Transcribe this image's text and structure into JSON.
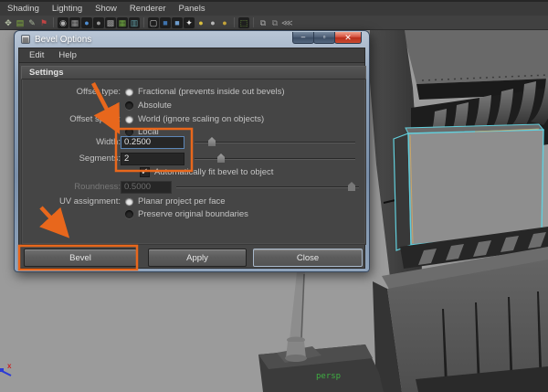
{
  "menu_bar": {
    "items": [
      "Shading",
      "Lighting",
      "Show",
      "Renderer",
      "Panels"
    ]
  },
  "toolbar": {
    "icons": [
      {
        "name": "select-tool-icon",
        "glyph": "✥",
        "fg": "#b8c4a8",
        "bg": "transparent"
      },
      {
        "name": "layer-book-icon",
        "glyph": "▤",
        "fg": "#86b33f",
        "bg": "transparent"
      },
      {
        "name": "graph-icon",
        "glyph": "✎",
        "fg": "#a9b79a",
        "bg": "transparent"
      },
      {
        "name": "key-icon",
        "glyph": "⚑",
        "fg": "#c24545",
        "bg": "transparent"
      },
      {
        "sep": true
      },
      {
        "name": "camera-icon",
        "glyph": "◉",
        "fg": "#b5b5b5",
        "bg": "#1f1f1f"
      },
      {
        "name": "film-gate-icon",
        "glyph": "▦",
        "fg": "#9b9b9b",
        "bg": "#1f1f1f"
      },
      {
        "name": "shaded-sphere-icon",
        "glyph": "●",
        "fg": "#4f8fd4",
        "bg": "#1f1f1f"
      },
      {
        "name": "wire-sphere-icon",
        "glyph": "●",
        "fg": "#9a9a9a",
        "bg": "#1f1f1f"
      },
      {
        "name": "checker-icon",
        "glyph": "▩",
        "fg": "#a5a5a5",
        "bg": "#1f1f1f"
      },
      {
        "name": "texture-grid-icon",
        "glyph": "▦",
        "fg": "#74b043",
        "bg": "#1f1f1f"
      },
      {
        "name": "film-strip-icon",
        "glyph": "▥",
        "fg": "#62a0a8",
        "bg": "#1f1f1f"
      },
      {
        "sep": true
      },
      {
        "name": "wire-cube-icon",
        "glyph": "▢",
        "fg": "#cfcfcf",
        "bg": "#1f1f1f"
      },
      {
        "name": "blue-cube-icon",
        "glyph": "■",
        "fg": "#3f74b0",
        "bg": "#1f1f1f"
      },
      {
        "name": "shaded-cube-icon",
        "glyph": "■",
        "fg": "#6f9fd0",
        "bg": "#1f1f1f"
      },
      {
        "name": "sparkle-icon",
        "glyph": "✦",
        "fg": "#e8e8e8",
        "bg": "#1f1f1f"
      },
      {
        "name": "yellow-light-icon",
        "glyph": "●",
        "fg": "#ddc23f",
        "bg": "transparent"
      },
      {
        "name": "gray-light-icon",
        "glyph": "●",
        "fg": "#b9b9b9",
        "bg": "transparent"
      },
      {
        "name": "amber-light-icon",
        "glyph": "●",
        "fg": "#c7a63a",
        "bg": "transparent"
      },
      {
        "sep": true
      },
      {
        "name": "snap-select-icon",
        "glyph": "⬚",
        "fg": "#7fb043",
        "bg": "#1f1f1f"
      },
      {
        "sep": true
      },
      {
        "name": "copy-layer-icon",
        "glyph": "⧉",
        "fg": "#ababab",
        "bg": "transparent"
      },
      {
        "name": "duplicate-icon",
        "glyph": "⧉",
        "fg": "#8f8f8f",
        "bg": "transparent"
      },
      {
        "name": "share-icon",
        "glyph": "⋘",
        "fg": "#9f9f9f",
        "bg": "transparent"
      }
    ]
  },
  "dialog": {
    "title": "Bevel Options",
    "title_icon_glyph": "▦",
    "window_controls": {
      "minimize": "–",
      "maximize": "▫",
      "close": "✕"
    },
    "menu": [
      "Edit",
      "Help"
    ],
    "section_title": "Settings",
    "fields": {
      "offset_type": {
        "label": "Offset type:",
        "options": [
          {
            "label": "Fractional (prevents inside out bevels)",
            "selected": true
          },
          {
            "label": "Absolute",
            "selected": false
          }
        ]
      },
      "offset_space": {
        "label": "Offset space:",
        "options": [
          {
            "label": "World (ignore scaling on objects)",
            "selected": true
          },
          {
            "label": "Local",
            "selected": false
          }
        ]
      },
      "width": {
        "label": "Width:",
        "value": "0.2500"
      },
      "segments": {
        "label": "Segments:",
        "value": "2"
      },
      "auto_fit": {
        "label": "Automatically fit bevel to object",
        "checked": true,
        "check_glyph": "✓"
      },
      "roundness": {
        "label": "Roundness:",
        "value": "0.5000",
        "disabled": true
      },
      "uv_assignment": {
        "label": "UV assignment:",
        "options": [
          {
            "label": "Planar project per face",
            "selected": true
          },
          {
            "label": "Preserve original boundaries",
            "selected": false
          }
        ]
      }
    },
    "buttons": [
      "Bevel",
      "Apply",
      "Close"
    ]
  },
  "viewport": {
    "camera_label": "persp",
    "axis_label": "x",
    "selection_color": "#62cfdc",
    "background_color": "#9b9b9b"
  },
  "annotations": {
    "highlight_color": "#e8671c"
  }
}
